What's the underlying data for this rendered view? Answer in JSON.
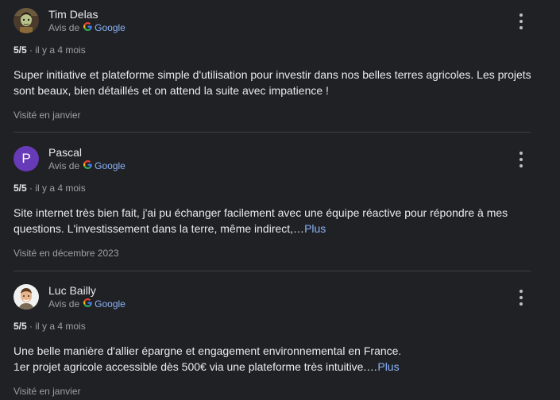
{
  "reviews": [
    {
      "author": "Tim Delas",
      "avatar_type": "photo-cartoon-icon",
      "source_prefix": "Avis de",
      "source_name": "Google",
      "rating": "5/5",
      "separator": " · ",
      "time": "il y a 4 mois",
      "text": "Super initiative et plateforme simple d'utilisation pour investir dans nos belles terres agricoles. Les projets sont beaux, bien détaillés et on attend la suite avec impatience !",
      "more_label": "",
      "visited": "Visité en janvier"
    },
    {
      "author": "Pascal",
      "avatar_letter": "P",
      "source_prefix": "Avis de",
      "source_name": "Google",
      "rating": "5/5",
      "separator": " · ",
      "time": "il y a 4 mois",
      "text": "Site internet très bien fait, j'ai pu échanger facilement avec une équipe réactive pour répondre à mes questions. L'investissement dans la terre, même indirect,…",
      "more_label": "Plus",
      "visited": "Visité en décembre 2023"
    },
    {
      "author": "Luc Bailly",
      "avatar_type": "photo-person-icon",
      "source_prefix": "Avis de",
      "source_name": "Google",
      "rating": "5/5",
      "separator": " · ",
      "time": "il y a 4 mois",
      "text": "Une belle manière d'allier épargne et engagement environnemental en France.\n1er projet agricole accessible dès 500€ via une plateforme très intuitive.…",
      "more_label": "Plus",
      "visited": "Visité en janvier"
    }
  ],
  "colors": {
    "background": "#202124",
    "link": "#8ab4f8",
    "muted": "#9aa0a6",
    "avatar_letter_bg": "#673ab7"
  }
}
